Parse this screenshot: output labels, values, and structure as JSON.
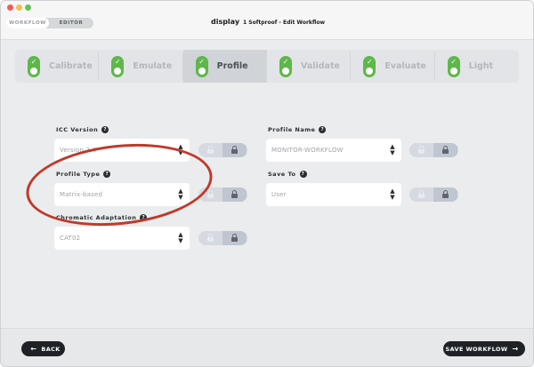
{
  "window": {
    "title": "display",
    "subtitle": "1 Softproof - Edit Workflow"
  },
  "mode_toggle": {
    "workflow_label": "WORKFLOW",
    "editor_label": "EDITOR",
    "selected": "WORKFLOW"
  },
  "steps": [
    {
      "label": "Calibrate",
      "completed": true,
      "active": false
    },
    {
      "label": "Emulate",
      "completed": true,
      "active": false
    },
    {
      "label": "Profile",
      "completed": true,
      "active": true
    },
    {
      "label": "Validate",
      "completed": true,
      "active": false
    },
    {
      "label": "Evaluate",
      "completed": true,
      "active": false
    },
    {
      "label": "Light",
      "completed": true,
      "active": false
    }
  ],
  "form": {
    "icc_version": {
      "label": "ICC Version",
      "value": "Version 2.4",
      "locked": true
    },
    "profile_type": {
      "label": "Profile Type",
      "value": "Matrix-based",
      "locked": true
    },
    "chromatic_adaptation": {
      "label": "Chromatic Adaptation",
      "value": "CAT02",
      "locked": true
    },
    "profile_name": {
      "label": "Profile Name",
      "value": "MONITOR-WORKFLOW",
      "locked": true
    },
    "save_to": {
      "label": "Save To",
      "value": "User",
      "locked": true
    }
  },
  "footer": {
    "back_label": "BACK",
    "save_label": "SAVE WORKFLOW"
  },
  "colors": {
    "step_check": "#5fb74a",
    "annotation": "#c0392b",
    "button_bg": "#1e2227"
  }
}
